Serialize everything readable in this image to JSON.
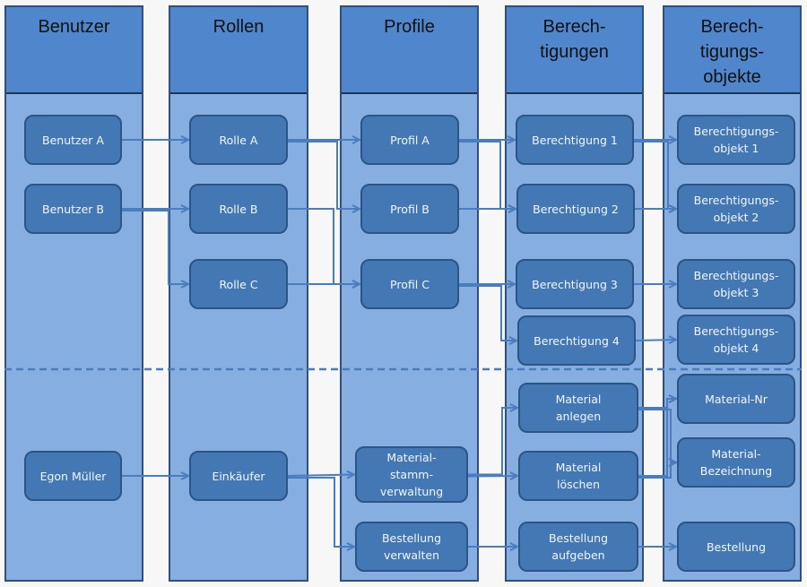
{
  "columns": [
    {
      "title": "Benutzer"
    },
    {
      "title": "Rollen"
    },
    {
      "title": "Profile"
    },
    {
      "title": "Berech-\ntigungen"
    },
    {
      "title": "Berech-\ntigungs-\nobjekte"
    }
  ],
  "nodes": {
    "benutzer_a": "Benutzer A",
    "benutzer_b": "Benutzer B",
    "egon": "Egon Müller",
    "rolle_a": "Rolle A",
    "rolle_b": "Rolle B",
    "rolle_c": "Rolle C",
    "einkaeufer": "Einkäufer",
    "profil_a": "Profil A",
    "profil_b": "Profil B",
    "profil_c": "Profil C",
    "materialstamm": "Material-\nstamm-\nverwaltung",
    "bestellung_verwalten": "Bestellung\nverwalten",
    "ber1": "Berechtigung 1",
    "ber2": "Berechtigung 2",
    "ber3": "Berechtigung 3",
    "ber4": "Berechtigung 4",
    "mat_anlegen": "Material\nanlegen",
    "mat_loeschen": "Material\nlöschen",
    "best_aufgeben": "Bestellung\naufgeben",
    "obj1": "Berechtigungs-\nobjekt 1",
    "obj2": "Berechtigungs-\nobjekt 2",
    "obj3": "Berechtigungs-\nobjekt 3",
    "obj4": "Berechtigungs-\nobjekt 4",
    "mat_nr": "Material-Nr",
    "mat_bez": "Material-\nBezeichnung",
    "bestellung": "Bestellung"
  },
  "edges": [
    [
      "benutzer_a",
      "rolle_a"
    ],
    [
      "benutzer_b",
      "rolle_b"
    ],
    [
      "benutzer_b",
      "rolle_c"
    ],
    [
      "egon",
      "einkaeufer"
    ],
    [
      "rolle_a",
      "profil_a"
    ],
    [
      "rolle_a",
      "profil_b"
    ],
    [
      "rolle_b",
      "profil_c"
    ],
    [
      "rolle_c",
      "profil_c"
    ],
    [
      "einkaeufer",
      "materialstamm"
    ],
    [
      "einkaeufer",
      "bestellung_verwalten"
    ],
    [
      "profil_a",
      "ber1"
    ],
    [
      "profil_a",
      "ber2"
    ],
    [
      "profil_b",
      "ber2"
    ],
    [
      "profil_c",
      "ber3"
    ],
    [
      "profil_c",
      "ber4"
    ],
    [
      "materialstamm",
      "mat_anlegen"
    ],
    [
      "materialstamm",
      "mat_loeschen"
    ],
    [
      "bestellung_verwalten",
      "best_aufgeben"
    ],
    [
      "ber1",
      "obj1"
    ],
    [
      "ber1",
      "obj2"
    ],
    [
      "ber2",
      "obj2"
    ],
    [
      "ber3",
      "obj3"
    ],
    [
      "ber4",
      "obj4"
    ],
    [
      "mat_anlegen",
      "mat_nr"
    ],
    [
      "mat_anlegen",
      "mat_bez"
    ],
    [
      "mat_loeschen",
      "mat_nr"
    ],
    [
      "mat_loeschen",
      "mat_bez"
    ],
    [
      "best_aufgeben",
      "bestellung"
    ]
  ],
  "colors": {
    "header": "#4f86cc",
    "lane": "#86aee0",
    "node": "#4478b4",
    "line": "#4a7cc0"
  }
}
